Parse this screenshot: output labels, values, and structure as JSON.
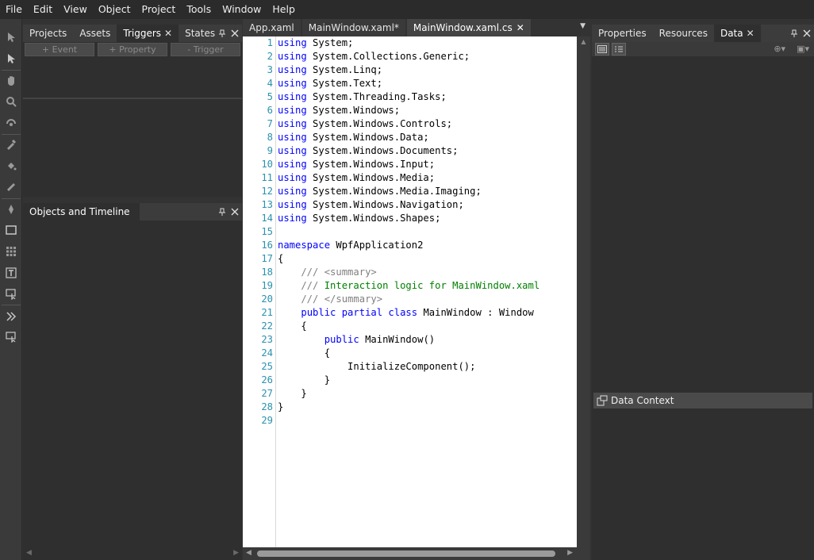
{
  "menu": [
    "File",
    "Edit",
    "View",
    "Object",
    "Project",
    "Tools",
    "Window",
    "Help"
  ],
  "left_top": {
    "tabs": [
      {
        "label": "Projects"
      },
      {
        "label": "Assets"
      },
      {
        "label": "Triggers"
      },
      {
        "label": "States"
      }
    ],
    "buttons": {
      "event": "+ Event",
      "property": "+ Property",
      "trigger": "- Trigger"
    }
  },
  "left_bottom": {
    "tab": "Objects and Timeline"
  },
  "editor": {
    "tabs": [
      {
        "label": "App.xaml"
      },
      {
        "label": "MainWindow.xaml*"
      },
      {
        "label": "MainWindow.xaml.cs"
      }
    ],
    "lines": [
      {
        "n": "1",
        "kw": "using",
        "rest": " System;"
      },
      {
        "n": "2",
        "kw": "using",
        "rest": " System.Collections.Generic;"
      },
      {
        "n": "3",
        "kw": "using",
        "rest": " System.Linq;"
      },
      {
        "n": "4",
        "kw": "using",
        "rest": " System.Text;"
      },
      {
        "n": "5",
        "kw": "using",
        "rest": " System.Threading.Tasks;"
      },
      {
        "n": "6",
        "kw": "using",
        "rest": " System.Windows;"
      },
      {
        "n": "7",
        "kw": "using",
        "rest": " System.Windows.Controls;"
      },
      {
        "n": "8",
        "kw": "using",
        "rest": " System.Windows.Data;"
      },
      {
        "n": "9",
        "kw": "using",
        "rest": " System.Windows.Documents;"
      },
      {
        "n": "10",
        "kw": "using",
        "rest": " System.Windows.Input;"
      },
      {
        "n": "11",
        "kw": "using",
        "rest": " System.Windows.Media;"
      },
      {
        "n": "12",
        "kw": "using",
        "rest": " System.Windows.Media.Imaging;"
      },
      {
        "n": "13",
        "kw": "using",
        "rest": " System.Windows.Navigation;"
      },
      {
        "n": "14",
        "kw": "using",
        "rest": " System.Windows.Shapes;"
      },
      {
        "n": "15",
        "kw": "",
        "rest": ""
      },
      {
        "n": "16",
        "kw": "namespace",
        "rest": " WpfApplication2"
      },
      {
        "n": "17",
        "kw": "",
        "rest": "{"
      },
      {
        "n": "18",
        "doc": "    /// ",
        "tag": "<summary>"
      },
      {
        "n": "19",
        "doc": "    /// ",
        "comment": "Interaction logic for MainWindow.xaml"
      },
      {
        "n": "20",
        "doc": "    /// ",
        "tag": "</summary>"
      },
      {
        "n": "21",
        "indent": "    ",
        "kw": "public partial class",
        "rest": " MainWindow : Window"
      },
      {
        "n": "22",
        "kw": "",
        "rest": "    {"
      },
      {
        "n": "23",
        "indent": "        ",
        "kw": "public",
        "rest": " MainWindow()"
      },
      {
        "n": "24",
        "kw": "",
        "rest": "        {"
      },
      {
        "n": "25",
        "kw": "",
        "rest": "            InitializeComponent();"
      },
      {
        "n": "26",
        "kw": "",
        "rest": "        }"
      },
      {
        "n": "27",
        "kw": "",
        "rest": "    }"
      },
      {
        "n": "28",
        "kw": "",
        "rest": "}"
      },
      {
        "n": "29",
        "kw": "",
        "rest": ""
      }
    ]
  },
  "right": {
    "tabs": [
      {
        "label": "Properties"
      },
      {
        "label": "Resources"
      },
      {
        "label": "Data"
      }
    ],
    "data_context": "Data Context"
  },
  "colors": {
    "keyword": "#0000ff",
    "comment": "#008000",
    "doc_tag": "#808080",
    "line_number": "#2b91af"
  }
}
